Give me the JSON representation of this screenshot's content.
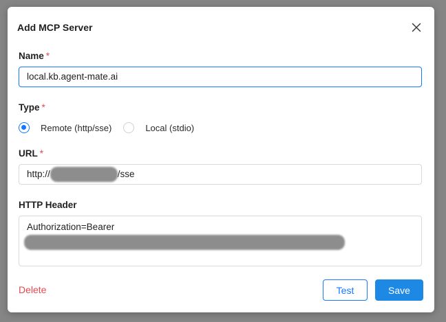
{
  "dialog": {
    "title": "Add MCP Server",
    "close_icon": "close-icon"
  },
  "form": {
    "required_mark": "*",
    "name": {
      "label": "Name",
      "value": "local.kb.agent-mate.ai"
    },
    "type": {
      "label": "Type",
      "options": [
        {
          "label": "Remote (http/sse)",
          "checked": true
        },
        {
          "label": "Local (stdio)",
          "checked": false
        }
      ]
    },
    "url": {
      "label": "URL",
      "prefix": "http://",
      "suffix": "/sse"
    },
    "http_header": {
      "label": "HTTP Header",
      "line1": "Authorization=Bearer"
    }
  },
  "actions": {
    "delete_label": "Delete",
    "test_label": "Test",
    "save_label": "Save"
  },
  "colors": {
    "accent": "#1677ff",
    "save_bg": "#1e88e5",
    "danger": "#e5484d"
  }
}
